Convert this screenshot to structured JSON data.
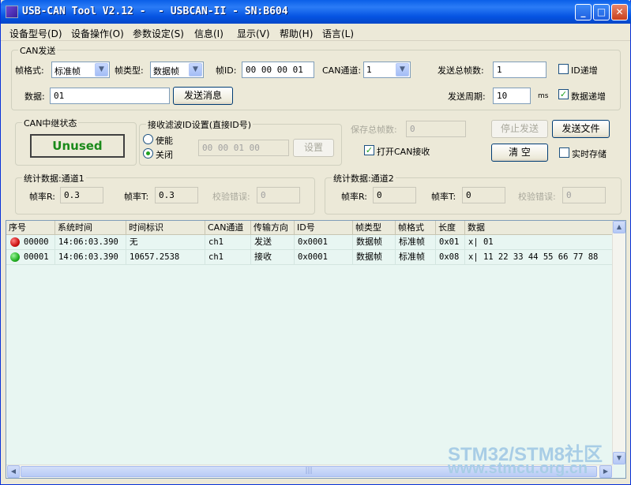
{
  "window": {
    "title": "USB-CAN Tool V2.12 -  - USBCAN-II - SN:B604",
    "minimize": "_",
    "maximize": "□",
    "close": "✕"
  },
  "menu": [
    "设备型号(D)",
    "设备操作(O)",
    "参数设定(S)",
    "信息(I)",
    "显示(V)",
    "帮助(H)",
    "语言(L)"
  ],
  "can_send": {
    "group_title": "CAN发送",
    "frame_format_label": "帧格式:",
    "frame_format_value": "标准帧",
    "frame_type_label": "帧类型:",
    "frame_type_value": "数据帧",
    "frame_id_label": "帧ID:",
    "frame_id_value": "00 00 00 01",
    "channel_label": "CAN通道:",
    "channel_value": "1",
    "total_frames_label": "发送总帧数:",
    "total_frames_value": "1",
    "id_increment_label": "ID递增",
    "data_label": "数据:",
    "data_value": "01",
    "send_button": "发送消息",
    "period_label": "发送周期:",
    "period_value": "10",
    "period_unit": "ms",
    "data_increment_label": "数据递增"
  },
  "relay": {
    "group_title": "CAN中继状态",
    "status": "Unused"
  },
  "filter": {
    "group_title": "接收滤波ID设置(直接ID号)",
    "enable_label": "使能",
    "close_label": "关闭",
    "id_value": "00 00 01 00",
    "set_button": "设置"
  },
  "save": {
    "saved_frames_label": "保存总帧数:",
    "saved_frames_value": "0",
    "open_can_receive_label": "打开CAN接收",
    "stop_send_button": "停止发送",
    "send_file_button": "发送文件",
    "clear_button": "清 空",
    "realtime_save_label": "实时存储"
  },
  "stats1": {
    "group_title": "统计数据:通道1",
    "rate_r_label": "帧率R:",
    "rate_r_value": "0.3",
    "rate_t_label": "帧率T:",
    "rate_t_value": "0.3",
    "checksum_label": "校验错误:",
    "checksum_value": "0"
  },
  "stats2": {
    "group_title": "统计数据:通道2",
    "rate_r_label": "帧率R:",
    "rate_r_value": "0",
    "rate_t_label": "帧率T:",
    "rate_t_value": "0",
    "checksum_label": "校验错误:",
    "checksum_value": "0"
  },
  "table": {
    "columns": [
      "序号",
      "系统时间",
      "时间标识",
      "CAN通道",
      "传输方向",
      "ID号",
      "帧类型",
      "帧格式",
      "长度",
      "数据"
    ],
    "rows": [
      {
        "status": "red",
        "cells": [
          "00000",
          "14:06:03.390",
          "无",
          "ch1",
          "发送",
          "0x0001",
          "数据帧",
          "标准帧",
          "0x01",
          "x| 01"
        ]
      },
      {
        "status": "green",
        "cells": [
          "00001",
          "14:06:03.390",
          "10657.2538",
          "ch1",
          "接收",
          "0x0001",
          "数据帧",
          "标准帧",
          "0x08",
          "x| 11 22 33 44 55 66 77 88"
        ]
      }
    ]
  },
  "watermark": {
    "line1": "STM32/STM8社区",
    "line2": "www.stmcu.org.cn"
  },
  "colors": {
    "title_blue": "#0553e2",
    "table_bg": "#e8f6f2",
    "relay_green": "#1a8a1a",
    "status_red": "#cc1111",
    "status_green": "#22b022"
  }
}
